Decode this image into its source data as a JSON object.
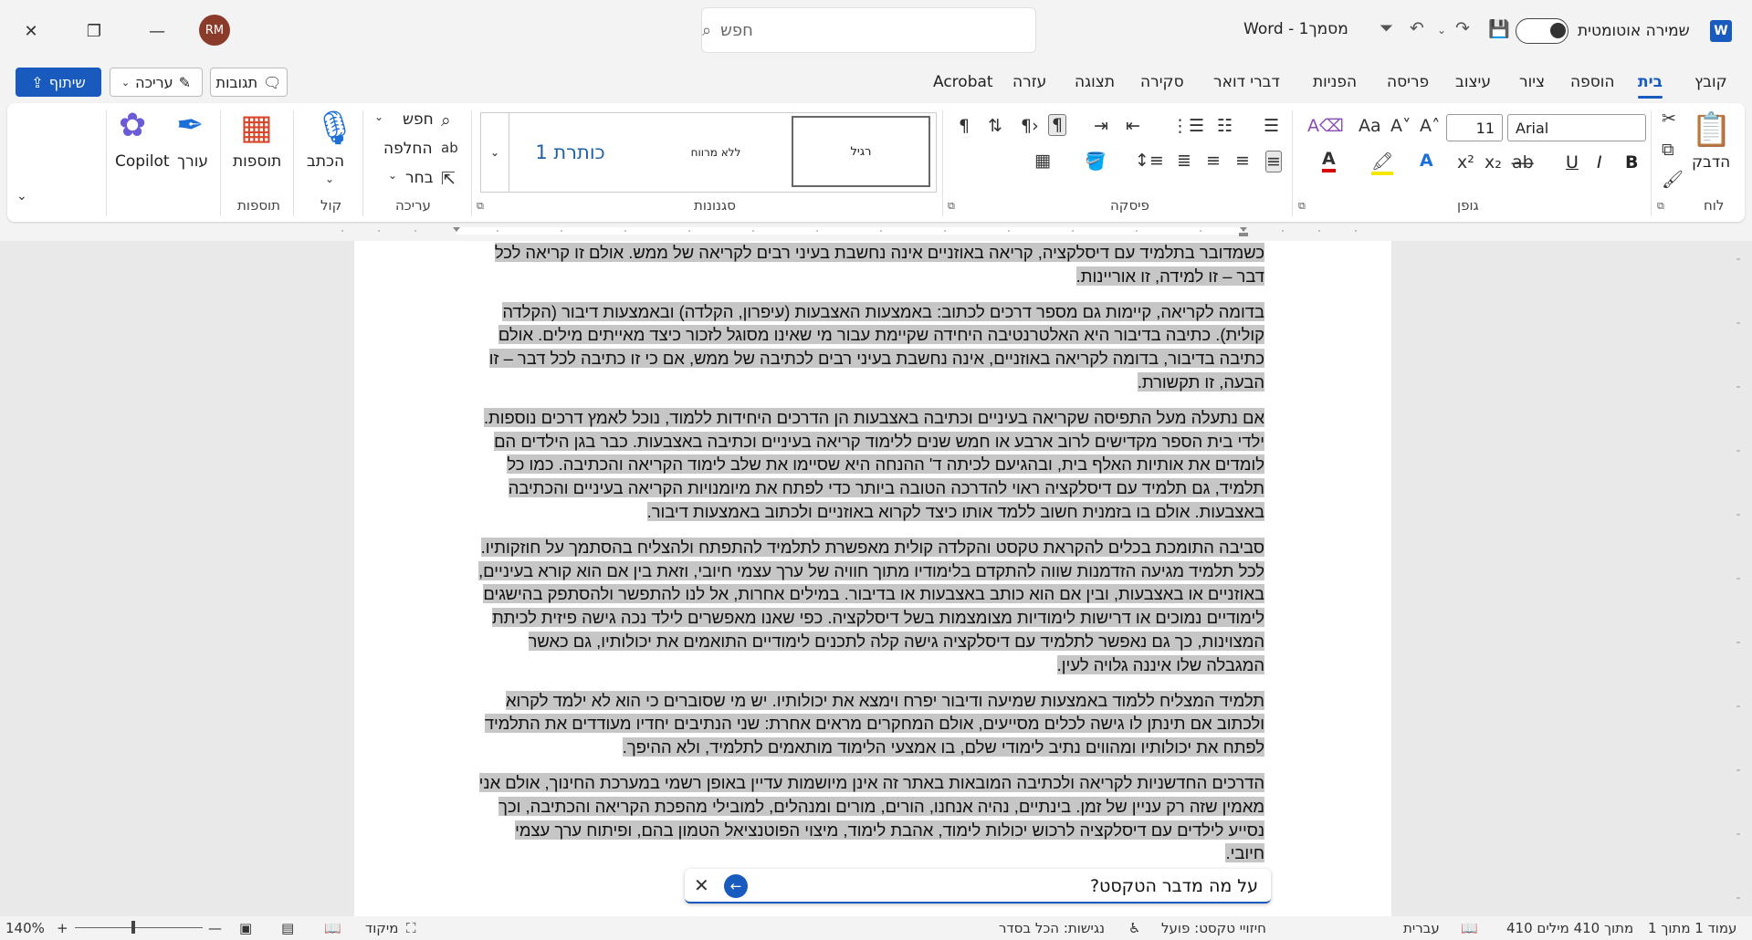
{
  "titlebar": {
    "app_name": "Word",
    "doc_name": "מסמך1",
    "separator": "-",
    "search_placeholder": "חפש",
    "autosave_label": "שמירה אוטומטית",
    "avatar_initials": "RM"
  },
  "menu": {
    "tabs": [
      "קובץ",
      "בית",
      "הוספה",
      "ציור",
      "עיצוב",
      "פריסה",
      "הפניות",
      "דברי דואר",
      "סקירה",
      "תצוגה",
      "עזרה",
      "Acrobat"
    ],
    "active_tab": "בית",
    "comments_label": "תגובות",
    "editing_label": "עריכה",
    "share_label": "שיתוף"
  },
  "ribbon": {
    "clipboard": {
      "paste": "הדבק",
      "group": "לוח"
    },
    "font": {
      "name": "Arial",
      "size": "11",
      "group": "גופן",
      "bold": "B",
      "italic": "I",
      "underline": "U"
    },
    "paragraph": {
      "group": "פיסקה"
    },
    "styles": {
      "items": [
        "רגיל",
        "ללא מרווח",
        "כותרת 1"
      ],
      "group": "סגנונות"
    },
    "editing": {
      "find": "חפש",
      "replace": "החלפה",
      "select": "בחר",
      "group": "עריכה"
    },
    "voice": {
      "dictate": "הכתב",
      "group": "קול"
    },
    "addins": {
      "label": "תוספות",
      "group": "תוספות"
    },
    "editor": {
      "label": "עורך"
    },
    "copilot": {
      "label": "Copilot"
    }
  },
  "document": {
    "paragraphs": [
      "כשמדובר בתלמיד עם דיסלקציה, קריאה באוזניים אינה נחשבת בעיני רבים לקריאה של ממש. אולם זו קריאה לכל דבר – זו למידה, זו אוריינות.",
      "בדומה לקריאה, קיימות גם מספר דרכים לכתוב: באמצעות האצבעות (עיפרון, הקלדה) ובאמצעות דיבור (הקלדה קולית). כתיבה בדיבור היא האלטרנטיבה היחידה שקיימת עבור מי שאינו מסוגל לזכור כיצד מאייתים מילים. אולם כתיבה בדיבור, בדומה לקריאה באוזניים, אינה נחשבת בעיני רבים לכתיבה של ממש, אם כי זו כתיבה לכל דבר – זו הבעה, זו תקשורת.",
      "אם נתעלה מעל התפיסה שקריאה בעיניים וכתיבה באצבעות הן הדרכים היחידות ללמוד, נוכל לאמץ דרכים נוספות. ילדי בית הספר מקדישים לרוב ארבע או חמש שנים ללימוד קריאה בעיניים וכתיבה באצבעות. כבר בגן הילדים הם לומדים את אותיות האלף בית, ובהגיעם לכיתה ד' ההנחה היא שסיימו את שלב לימוד הקריאה והכתיבה. כמו כל תלמיד, גם תלמיד עם דיסלקציה ראוי להדרכה הטובה ביותר כדי לפתח את מיומנויות הקריאה בעיניים והכתיבה באצבעות. אולם בו בזמנית חשוב ללמד אותו כיצד לקרוא באוזניים ולכתוב באמצעות דיבור.",
      "סביבה התומכת בכלים להקראת טקסט והקלדה קולית מאפשרת לתלמיד להתפתח ולהצליח בהסתמך על חוזקותיו. לכל תלמיד מגיעה הזדמנות שווה להתקדם בלימודיו מתוך חוויה של ערך עצמי חיובי, וזאת בין אם הוא קורא בעיניים, באוזניים או באצבעות, ובין אם הוא כותב באצבעות או בדיבור. במילים אחרות, אל לנו להתפשר ולהסתפק בהישגים לימודיים נמוכים או דרישות לימודיות מצומצמות בשל דיסלקציה. כפי שאנו מאפשרים לילד נכה גישה פיזית לכיתת המצוינות, כך גם נאפשר לתלמיד עם דיסלקציה גישה קלה לתכנים לימודיים התואמים את יכולותיו, גם כאשר המגבלה שלו איננה גלויה לעין.",
      "תלמיד המצליח ללמוד באמצעות שמיעה ודיבור יפרח וימצא את יכולותיו. יש מי שסוברים כי הוא לא ילמד לקרוא ולכתוב אם תינתן לו גישה לכלים מסייעים, אולם המחקרים מראים אחרת: שני הנתיבים יחדיו מעודדים את התלמיד לפתח את יכולותיו ומהווים נתיב לימודי שלם, בו אמצעי הלימוד מותאמים לתלמיד, ולא ההיפך.",
      "הדרכים החדשניות לקריאה ולכתיבה המובאות באתר זה אינן מיושמות עדיין באופן רשמי במערכת החינוך, אולם אני מאמין שזה רק עניין של זמן. בינתיים, נהיה אנחנו, הורים, מורים ומנהלים, למובילי מהפכת הקריאה והכתיבה, וכך נסייע לילדים עם דיסלקציה לרכוש יכולות לימוד, אהבת לימוד, מיצוי הפוטנציאל הטמון בהם, ופיתוח ערך עצמי חיובי."
    ]
  },
  "copilot_prompt": {
    "text": "על מה מדבר הטקסט?"
  },
  "statusbar": {
    "page": "עמוד 1 מתוך 1",
    "words": "410 מתוך 410 מילים",
    "language": "עברית",
    "predictions": "חיזויי טקסט: פועל",
    "accessibility": "נגישות: הכל בסדר",
    "focus": "מיקוד",
    "zoom": "140%"
  }
}
